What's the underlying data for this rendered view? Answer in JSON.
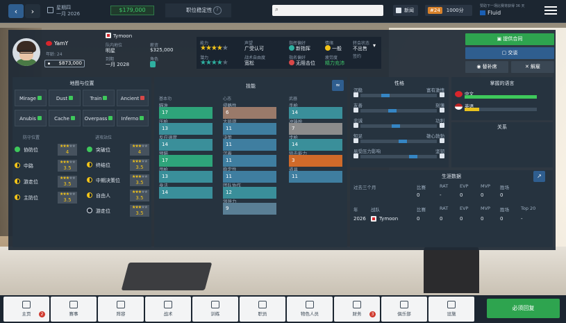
{
  "topbar": {
    "date_weekday": "星期四",
    "date": "一月 2026",
    "money": "$179,000",
    "stability_label": "职位稳定性",
    "stability_icon": "?",
    "search_placeholder": "",
    "news": "新闻",
    "rank": "#24",
    "points": "1000分",
    "sponsor_note": "赞助下一场比赛将获得 36 天",
    "sponsor_name": "Fluid"
  },
  "player": {
    "name": "YamY",
    "age": "年龄: 24",
    "value": "$873,000",
    "team": "Tymoon",
    "team_role_label": "队内地位",
    "team_role": "明星",
    "salary_label": "薪资",
    "salary": "$325,000",
    "contract_label": "到期",
    "contract": "一月 2028",
    "role_label": "角色"
  },
  "ratings": {
    "ability_label": "能力",
    "ability": "★★★★",
    "ability_empty": "★",
    "potential_label": "潜力",
    "potential": "★★★★",
    "potential_empty": "★",
    "reputation_label": "声望",
    "reputation": "广受认可",
    "attitude_label": "战术自由度",
    "attitude": "宽松",
    "leader_label": "指挥偏好",
    "leader": "新指挥",
    "mood_label": "情绪",
    "mood": "一般",
    "lane_label": "指名偏好",
    "lane": "无阻击位",
    "fatigue_label": "疲劳度",
    "fatigue": "精力充沛",
    "transfer_label": "转会状态",
    "transfer": "不出售",
    "transfer_sub": "签约"
  },
  "actions": {
    "offer": "提供合同",
    "chat": "交谈",
    "bench": "替补席",
    "release": "解雇"
  },
  "maps": {
    "title": "地图与位置",
    "items": [
      {
        "name": "Mirage",
        "trend": "up"
      },
      {
        "name": "Dust",
        "trend": "up"
      },
      {
        "name": "Train",
        "trend": "up"
      },
      {
        "name": "Ancient",
        "trend": "down"
      },
      {
        "name": "Anubis",
        "trend": "up"
      },
      {
        "name": "Cache",
        "trend": "up"
      },
      {
        "name": "Overpass",
        "trend": "up"
      },
      {
        "name": "Inferno",
        "trend": "up"
      }
    ]
  },
  "positions": {
    "defense_title": "防守位置",
    "attack_title": "进攻站位",
    "defense": [
      {
        "name": "协防位",
        "stars": "★★★",
        "empty": "★★",
        "val": "4"
      },
      {
        "name": "中路",
        "stars": "★★★",
        "empty": "★★",
        "val": "3.5"
      },
      {
        "name": "游走位",
        "stars": "★★★",
        "empty": "★★",
        "val": "3.5"
      },
      {
        "name": "主防位",
        "stars": "★★★",
        "empty": "★★",
        "val": "3.5"
      }
    ],
    "attack": [
      {
        "name": "突破位",
        "stars": "★★★",
        "empty": "★★",
        "val": "4"
      },
      {
        "name": "终结位",
        "stars": "★★★",
        "empty": "★★",
        "val": "3.5"
      },
      {
        "name": "中期决策位",
        "stars": "★★★",
        "empty": "★★",
        "val": "3.5"
      },
      {
        "name": "自由人",
        "stars": "★★★",
        "empty": "★★",
        "val": "3.5"
      },
      {
        "name": "游走位",
        "stars": "★★★",
        "empty": "★★",
        "val": "3.5"
      }
    ]
  },
  "skills": {
    "title": "技能",
    "col1_title": "基本功",
    "col2_title": "心态",
    "col3_title": "武器",
    "col1": [
      {
        "name": "瞄准",
        "value": "17"
      },
      {
        "name": "压枪",
        "value": "13"
      },
      {
        "name": "反应速度",
        "value": "14"
      },
      {
        "name": "预瞄",
        "value": "17"
      },
      {
        "name": "甩枪",
        "value": "13"
      },
      {
        "name": "身法",
        "value": "14"
      }
    ],
    "col2": [
      {
        "name": "侵略性",
        "value": "6"
      },
      {
        "name": "大局观",
        "value": "11"
      },
      {
        "name": "决策",
        "value": "11"
      },
      {
        "name": "沉着",
        "value": "11"
      },
      {
        "name": "稳定性",
        "value": "11"
      },
      {
        "name": "团队协作",
        "value": "12"
      },
      {
        "name": "领导力",
        "value": "9"
      }
    ],
    "col3": [
      {
        "name": "手枪",
        "value": "14"
      },
      {
        "name": "冲锋枪",
        "value": "7"
      },
      {
        "name": "步枪",
        "value": "14"
      },
      {
        "name": "狙击能力",
        "value": "3"
      },
      {
        "name": "道具",
        "value": "11"
      }
    ]
  },
  "personality": {
    "title": "性格",
    "rows": [
      {
        "left": "沉稳",
        "right": "富有激情",
        "pos": 0.3
      },
      {
        "left": "友善",
        "right": "刻薄",
        "pos": 0.4
      },
      {
        "left": "忠诚",
        "right": "功利",
        "pos": 0.45
      },
      {
        "left": "知足",
        "right": "雄心勃勃",
        "pos": 0.55
      },
      {
        "left": "易受压力影响",
        "right": "坚韧",
        "pos": 0.7
      }
    ]
  },
  "languages": {
    "title": "掌握的语言",
    "items": [
      {
        "name": "中文",
        "level": 1.0,
        "color": "#3ec85b"
      },
      {
        "name": "英语",
        "level": 0.2,
        "color": "#e8c21f"
      }
    ]
  },
  "relations": {
    "title": "关系"
  },
  "career": {
    "title": "生涯数据",
    "period": "过去三个月",
    "cols": [
      "比赛",
      "RAT",
      "EVP",
      "MVP",
      "胜场"
    ],
    "period_vals": [
      "0",
      "-",
      "0",
      "0",
      "0"
    ],
    "year_cols": [
      "年",
      "战队",
      "比赛",
      "RAT",
      "EVP",
      "MVP",
      "胜场",
      "Top 20"
    ],
    "rows": [
      {
        "year": "2026",
        "team": "Tymoon",
        "matches": "0",
        "rat": "0",
        "evp": "0",
        "mvp": "0",
        "wins": "0",
        "top": "-"
      }
    ]
  },
  "bottom": {
    "tabs": [
      {
        "label": "主页",
        "badge": "2"
      },
      {
        "label": "赛事",
        "badge": ""
      },
      {
        "label": "阵容",
        "badge": ""
      },
      {
        "label": "战术",
        "badge": ""
      },
      {
        "label": "训练",
        "badge": ""
      },
      {
        "label": "职员",
        "badge": ""
      },
      {
        "label": "物色人员",
        "badge": ""
      },
      {
        "label": "财务",
        "badge": "3"
      },
      {
        "label": "俱乐部",
        "badge": ""
      },
      {
        "label": "设施",
        "badge": ""
      }
    ],
    "continue": "必须回复"
  }
}
